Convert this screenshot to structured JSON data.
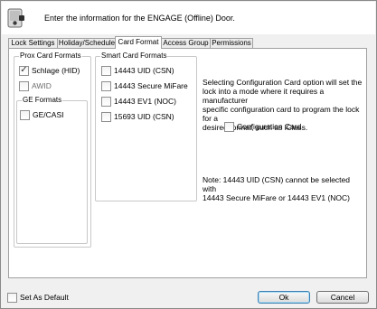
{
  "header": {
    "title": "Enter the information for the ENGAGE (Offline) Door.",
    "icon": "door-lock-icon"
  },
  "tabs": [
    {
      "label": "Lock Settings",
      "active": false
    },
    {
      "label": "Holiday/Schedule",
      "active": false
    },
    {
      "label": "Card Format",
      "active": true
    },
    {
      "label": "Access Group",
      "active": false
    },
    {
      "label": "Permissions",
      "active": false
    }
  ],
  "prox": {
    "title": "Prox Card Formats",
    "items": [
      {
        "label": "Schlage (HID)",
        "checked": true,
        "enabled": true
      },
      {
        "label": "AWID",
        "checked": false,
        "enabled": false
      }
    ]
  },
  "ge": {
    "title": "GE Formats",
    "items": [
      {
        "label": "GE/CASI",
        "checked": false,
        "enabled": true
      }
    ]
  },
  "smart": {
    "title": "Smart Card Formats",
    "items": [
      {
        "label": "14443 UID (CSN)",
        "checked": false,
        "enabled": true
      },
      {
        "label": "14443 Secure MiFare",
        "checked": false,
        "enabled": true
      },
      {
        "label": "14443 EV1 (NOC)",
        "checked": false,
        "enabled": true
      },
      {
        "label": "15693 UID (CSN)",
        "checked": false,
        "enabled": true
      }
    ]
  },
  "info_text": {
    "line1": "Selecting Configuration Card option will set the",
    "line2": "lock into a mode where it requires a manufacturer",
    "line3": "specific configuration card to program the lock for a",
    "line4": "desired format, such as iClass."
  },
  "config_card": {
    "label": "Configuration Card",
    "checked": false
  },
  "note": {
    "line1": "Note: 14443 UID (CSN) cannot be selected with",
    "line2": "14443 Secure MiFare or 14443 EV1 (NOC)"
  },
  "footer": {
    "set_default_label": "Set As Default",
    "set_default_checked": false,
    "ok_label": "Ok",
    "cancel_label": "Cancel"
  },
  "colors": {
    "window_bg": "#f0f0f0",
    "panel_bg": "#ffffff",
    "default_button_border": "#3c7fb1"
  }
}
